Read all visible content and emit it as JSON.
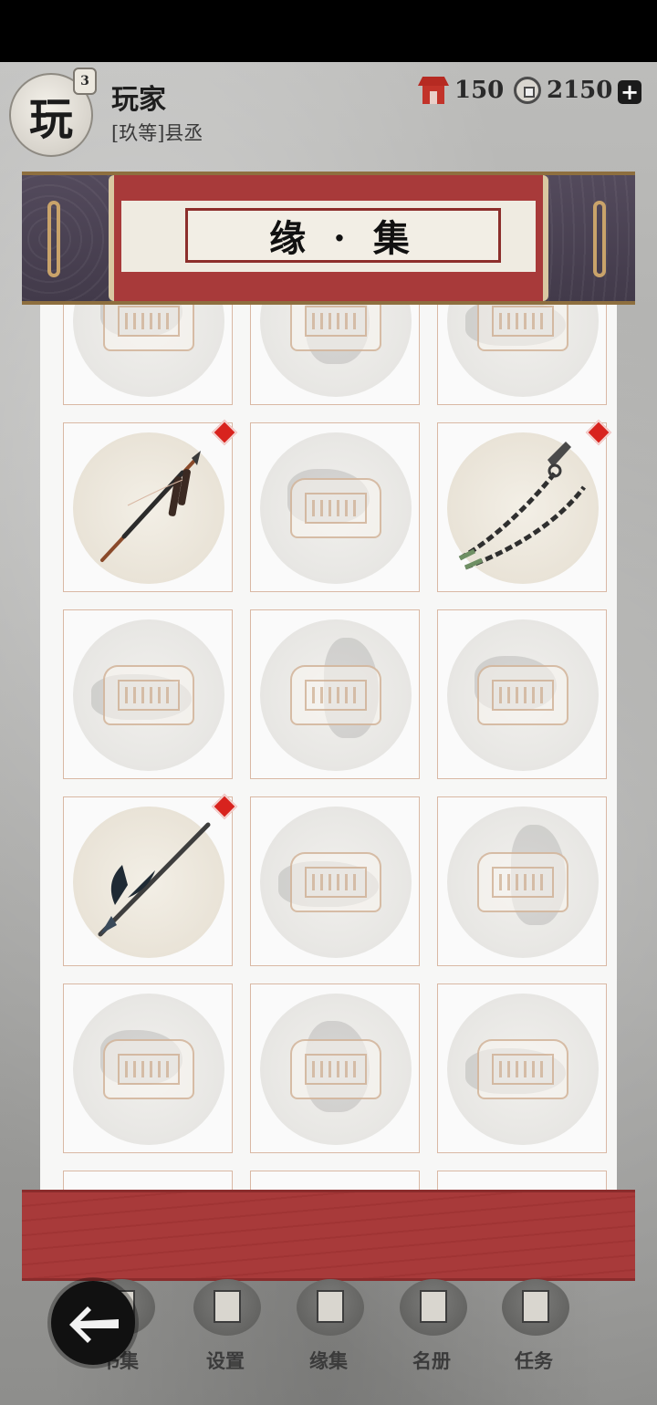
{
  "player": {
    "avatar_char": "玩",
    "level": "3",
    "name": "玩家",
    "rank": "[玖等]县丞"
  },
  "currency": {
    "tokens": "150",
    "coins": "2150"
  },
  "page": {
    "title": "缘 · 集"
  },
  "collection": {
    "rows": [
      [
        {
          "unlocked": false,
          "new": false
        },
        {
          "unlocked": false,
          "new": false
        },
        {
          "unlocked": false,
          "new": false
        }
      ],
      [
        {
          "unlocked": true,
          "new": true,
          "weapon": "spear-icon"
        },
        {
          "unlocked": false,
          "new": false
        },
        {
          "unlocked": true,
          "new": true,
          "weapon": "chain-whip-icon"
        }
      ],
      [
        {
          "unlocked": false,
          "new": false
        },
        {
          "unlocked": false,
          "new": false
        },
        {
          "unlocked": false,
          "new": false
        }
      ],
      [
        {
          "unlocked": true,
          "new": true,
          "weapon": "halberd-icon"
        },
        {
          "unlocked": false,
          "new": false
        },
        {
          "unlocked": false,
          "new": false
        }
      ],
      [
        {
          "unlocked": false,
          "new": false
        },
        {
          "unlocked": false,
          "new": false
        },
        {
          "unlocked": false,
          "new": false
        }
      ]
    ]
  },
  "nav": {
    "items": [
      {
        "label": "书集",
        "icon": "book-icon"
      },
      {
        "label": "设置",
        "icon": "settings-icon"
      },
      {
        "label": "缘集",
        "icon": "collection-icon"
      },
      {
        "label": "名册",
        "icon": "roster-icon"
      },
      {
        "label": "任务",
        "icon": "quest-icon"
      }
    ]
  },
  "colors": {
    "accent_red": "#a83a3a",
    "badge_red": "#d8231e",
    "banner_purple": "#4a4253"
  }
}
